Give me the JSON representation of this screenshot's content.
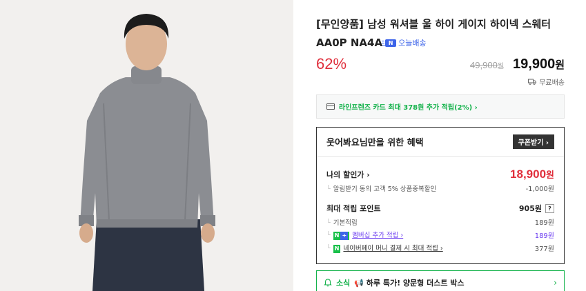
{
  "product": {
    "title": "[무인양품] 남성 워셔블 울 하이 게이지 하이넥 스웨터 AA0P NA4A",
    "delivery_badge": "오늘배송",
    "delivery_badge_icon": "n-delivery-icon",
    "discount_rate": "62%",
    "original_price": "49,900",
    "original_price_unit": "원",
    "sale_price": "19,900",
    "sale_price_unit": "원",
    "shipping": "무료배송",
    "image_alt": "grey high-neck sweater model photo"
  },
  "card_promo": {
    "icon": "credit-card-icon",
    "text": "라인프렌즈 카드 최대 378원 추가 적립(2%) ›"
  },
  "benefits": {
    "title": "웃어봐요님만을 위한 혜택",
    "coupon_button": "쿠폰받기 ›",
    "my_discount_label": "나의 할인가 ›",
    "my_discount_value": "18,900",
    "my_discount_unit": "원",
    "my_discount_sub": "알림받기 동의 고객 5% 상품중복할인",
    "my_discount_sub_value": "-1,000원",
    "points_label": "최대 적립 포인트",
    "points_value": "905원",
    "points_help": "?",
    "basic_points_label": "기본적립",
    "basic_points_value": "189원",
    "membership_badge": "N",
    "membership_badge_plus": "+",
    "membership_label": "멤버십 추가 적립 ›",
    "membership_value": "189원",
    "npay_badge": "N",
    "npay_label": "네이버페이 머니 결제 시 최대 적립 ›",
    "npay_value": "377원"
  },
  "notice": {
    "icon": "bell-icon",
    "label": "소식",
    "text": "📢 하루 특가! 양문형 더스트 박스",
    "chevron": "›"
  },
  "colors": {
    "accent_red": "#e02f3c",
    "naver_green": "#14b24b",
    "membership_purple": "#6b3cf0",
    "badge_blue": "#3d64e9"
  }
}
